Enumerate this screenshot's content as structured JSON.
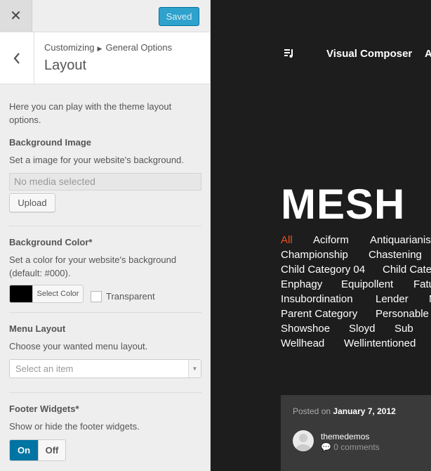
{
  "header": {
    "saved_label": "Saved"
  },
  "section": {
    "crumb_root": "Customizing",
    "crumb_child": "General Options",
    "title": "Layout"
  },
  "intro": "Here you can play with the theme layout options.",
  "background_image": {
    "title": "Background Image",
    "description": "Set a image for your website's background.",
    "media_placeholder": "No media selected",
    "upload_label": "Upload"
  },
  "background_color": {
    "title": "Background Color*",
    "description": "Set a color for your website's background (default: #000).",
    "current_color": "#000000",
    "select_color_label": "Select Color",
    "transparent_label": "Transparent"
  },
  "menu_layout": {
    "title": "Menu Layout",
    "description": "Choose your wanted menu layout.",
    "selected": "Select an item"
  },
  "footer_widgets": {
    "title": "Footer Widgets*",
    "description": "Show or hide the footer widgets.",
    "on_label": "On",
    "off_label": "Off",
    "value": "On"
  },
  "preview": {
    "nav_items": [
      "Visual Composer",
      "A"
    ],
    "site_title": "MESH",
    "accent_color": "#e9511c",
    "categories": [
      [
        "All",
        "Aciform",
        "Antiquarianis"
      ],
      [
        "Championship",
        "Chastening"
      ],
      [
        "Child Category 04",
        "Child Categ"
      ],
      [
        "Enphagy",
        "Equipollent",
        "Fatu"
      ],
      [
        "Insubordination",
        "Lender",
        "M"
      ],
      [
        "Parent Category",
        "Personable"
      ],
      [
        "Showshoe",
        "Sloyd",
        "Sub"
      ],
      [
        "Wellhead",
        "Wellintentioned"
      ]
    ],
    "post": {
      "posted_on_label": "Posted on",
      "date": "January 7, 2012",
      "author": "themedemos",
      "comments": "0 comments"
    }
  }
}
